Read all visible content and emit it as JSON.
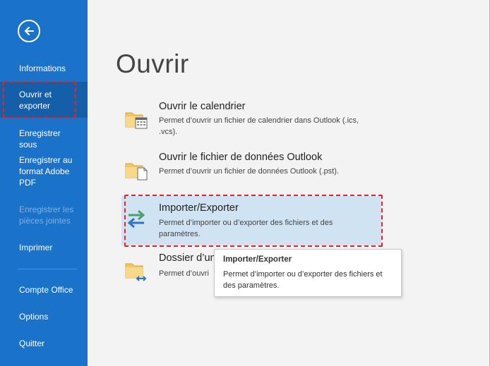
{
  "sidebar": {
    "back_icon": "back-arrow-icon",
    "items": [
      {
        "label": "Informations",
        "state": "normal"
      },
      {
        "label": "Ouvrir et exporter",
        "state": "active"
      },
      {
        "label": "Enregistrer sous",
        "state": "normal"
      },
      {
        "label": "Enregistrer au format Adobe PDF",
        "state": "normal"
      },
      {
        "label": "Enregistrer les pièces jointes",
        "state": "disabled"
      },
      {
        "label": "Imprimer",
        "state": "normal"
      },
      {
        "label": "Compte Office",
        "state": "normal"
      },
      {
        "label": "Options",
        "state": "normal"
      },
      {
        "label": "Quitter",
        "state": "normal"
      }
    ]
  },
  "main": {
    "title": "Ouvrir",
    "options": [
      {
        "title": "Ouvrir le calendrier",
        "description": "Permet d’ouvrir un fichier de calendrier dans Outlook (.ics, .vcs).",
        "icon": "folder-calendar-icon"
      },
      {
        "title": "Ouvrir le fichier de données Outlook",
        "description": "Permet d’ouvrir un fichier de données Outlook (.pst).",
        "icon": "folder-file-icon"
      },
      {
        "title": "Importer/Exporter",
        "description": "Permet d’importer ou d’exporter des fichiers et des paramètres.",
        "icon": "import-export-arrows-icon"
      },
      {
        "title": "Dossier d’un",
        "description": "Permet d’ouvri",
        "icon": "folder-shared-icon"
      }
    ]
  },
  "tooltip": {
    "title": "Importer/Exporter",
    "text": "Permet d’importer ou d’exporter des fichiers et des paramètres."
  },
  "colors": {
    "sidebar_bg": "#1a73c8",
    "sidebar_active": "#145fa8",
    "hover_bg": "#cfe3f3",
    "annotation_red": "#e8202a"
  }
}
